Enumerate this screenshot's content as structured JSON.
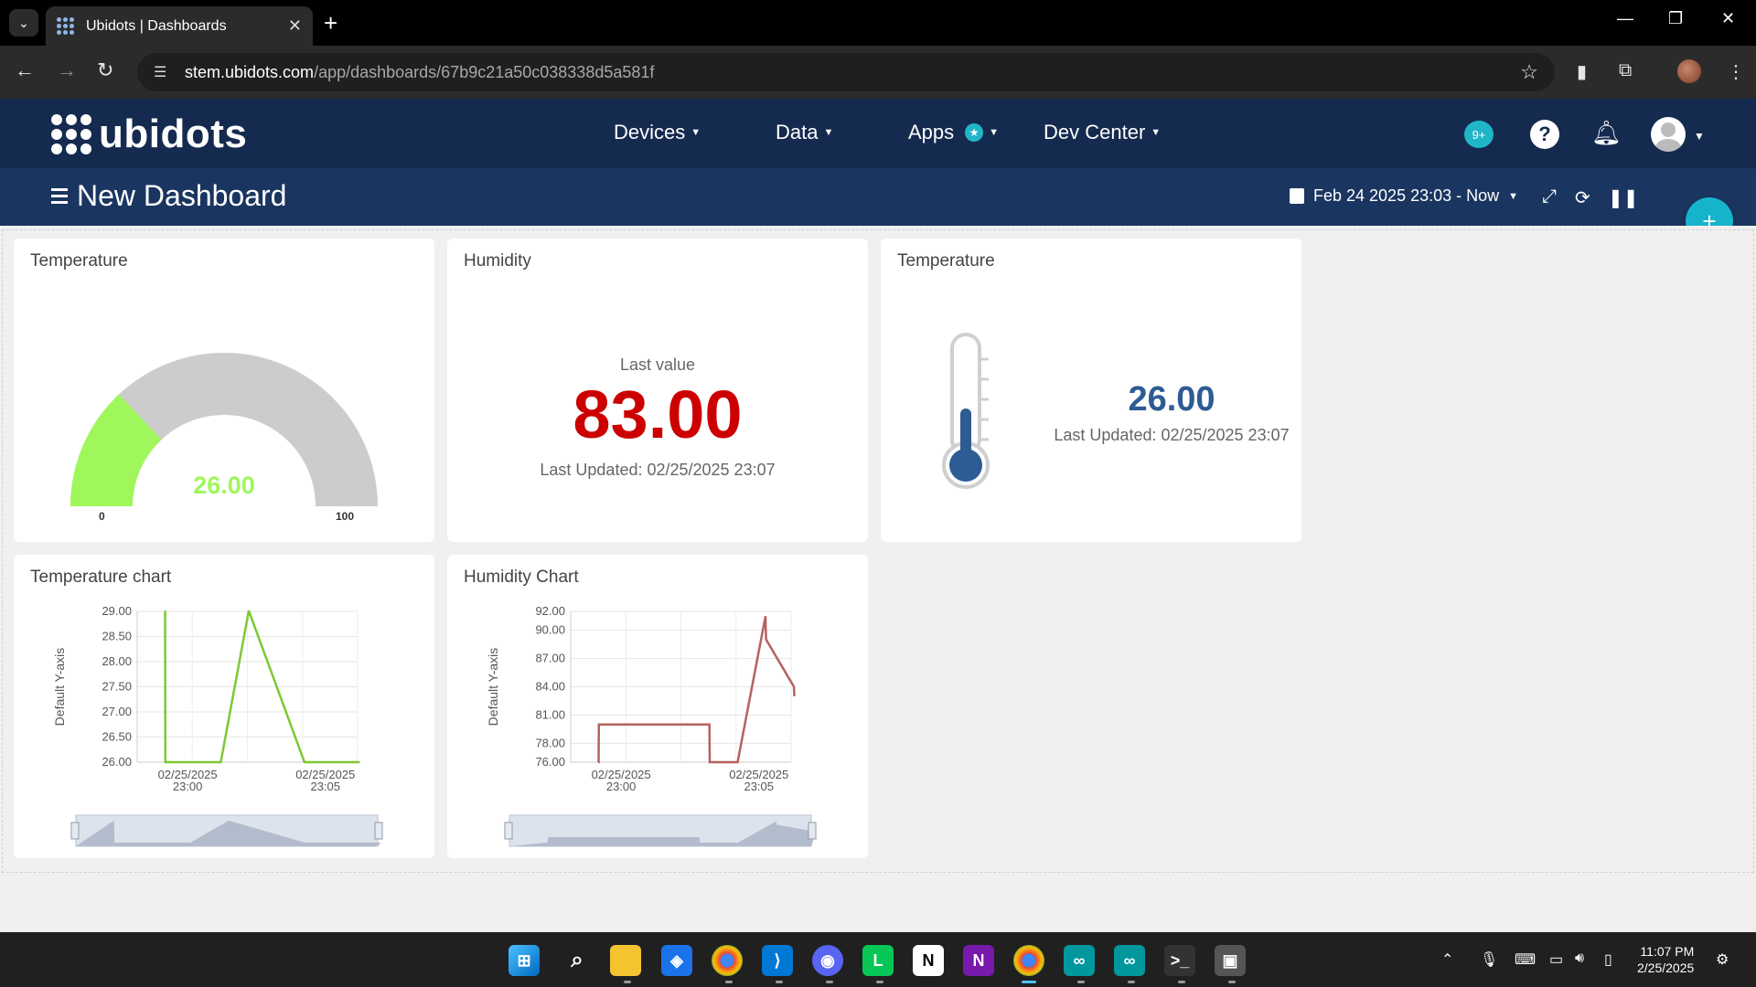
{
  "browser": {
    "tab_title": "Ubidots | Dashboards",
    "tab_close": "✕",
    "new_tab": "+",
    "url_host": "stem.ubidots.com",
    "url_path": "/app/dashboards/67b9c21a50c038338d5a581f"
  },
  "header": {
    "logo": "ubidots",
    "menu": [
      {
        "label": "Devices"
      },
      {
        "label": "Data"
      },
      {
        "label": "Apps",
        "badge": "★"
      },
      {
        "label": "Dev Center"
      }
    ],
    "notifications": "9+",
    "help": "?"
  },
  "dashboard": {
    "title": "New Dashboard",
    "date_range": "Feb 24 2025 23:03 - Now",
    "add": "+"
  },
  "widgets": {
    "gauge": {
      "title": "Temperature",
      "value": "26.00",
      "min": "0",
      "max": "100",
      "level": 0.26,
      "color": "#9ff75c"
    },
    "metric": {
      "title": "Humidity",
      "label": "Last value",
      "value": "83.00",
      "updated": "Last Updated: 02/25/2025 23:07",
      "color": "#cc0000"
    },
    "thermo": {
      "title": "Temperature",
      "value": "26.00",
      "updated": "Last Updated: 02/25/2025 23:07",
      "color": "#2d5b94"
    },
    "temp_chart": {
      "title": "Temperature chart"
    },
    "hum_chart": {
      "title": "Humidity Chart"
    }
  },
  "chart_data": [
    {
      "type": "line",
      "title": "Temperature chart",
      "ylabel": "Default Y-axis",
      "y_ticks": [
        "29.00",
        "28.50",
        "28.00",
        "27.50",
        "27.00",
        "26.50",
        "26.00"
      ],
      "x_ticks": [
        [
          "02/25/2025",
          "23:00"
        ],
        [
          "02/25/2025",
          "23:05"
        ]
      ],
      "ylim": [
        26,
        29
      ],
      "color": "#7dc832",
      "points": [
        [
          "23:00",
          29.0
        ],
        [
          "23:00",
          29.0
        ],
        [
          "23:00",
          26.0
        ],
        [
          "23:02",
          26.0
        ],
        [
          "23:03",
          29.0
        ],
        [
          "23:03",
          29.0
        ],
        [
          "23:05",
          26.0
        ],
        [
          "23:07",
          26.0
        ]
      ]
    },
    {
      "type": "line",
      "title": "Humidity Chart",
      "ylabel": "Default Y-axis",
      "y_ticks": [
        "92.00",
        "90.00",
        "87.00",
        "84.00",
        "81.00",
        "78.00",
        "76.00"
      ],
      "x_ticks": [
        [
          "02/25/2025",
          "23:00"
        ],
        [
          "02/25/2025",
          "23:05"
        ]
      ],
      "ylim": [
        76,
        92
      ],
      "color": "#b5625e",
      "points": [
        [
          "23:00",
          76.0
        ],
        [
          "23:00",
          76.0
        ],
        [
          "23:00",
          80.0
        ],
        [
          "23:04",
          80.0
        ],
        [
          "23:04",
          76.0
        ],
        [
          "23:05",
          76.0
        ],
        [
          "23:06",
          91.5
        ],
        [
          "23:06",
          90.0
        ],
        [
          "23:06",
          89.0
        ],
        [
          "23:07",
          84.0
        ],
        [
          "23:07",
          83.0
        ]
      ]
    }
  ],
  "taskbar": {
    "time": "11:07 PM",
    "date": "2/25/2025"
  }
}
